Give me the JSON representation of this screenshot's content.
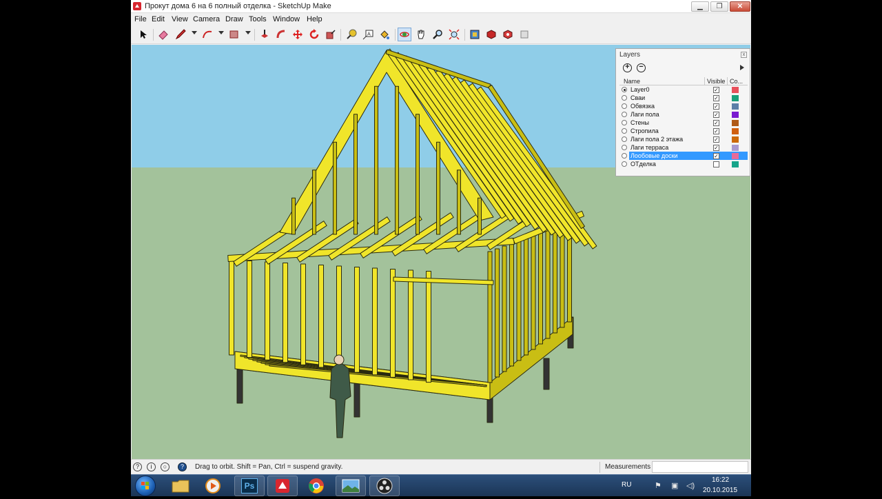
{
  "window": {
    "title": "Прокут дома 6 на 6 полный отделка - SketchUp Make",
    "minimize": "▁",
    "maximize": "❐",
    "close": "✕"
  },
  "menu": [
    "File",
    "Edit",
    "View",
    "Camera",
    "Draw",
    "Tools",
    "Window",
    "Help"
  ],
  "toolbar": {
    "tools": [
      "select-icon",
      "eraser-icon",
      "pencil-icon",
      "arc-icon",
      "rectangle-icon",
      "push-pull-icon",
      "follow-me-icon",
      "move-icon",
      "rotate-icon",
      "scale-icon",
      "tape-measure-icon",
      "text-icon",
      "paint-bucket-icon",
      "orbit-icon",
      "pan-icon",
      "zoom-icon",
      "zoom-extents-icon",
      "warehouse-icon",
      "extension-icon",
      "components-icon",
      "layout-icon"
    ],
    "active_tool": "orbit-icon"
  },
  "layers_panel": {
    "title": "Layers",
    "add": "+",
    "remove": "−",
    "columns": {
      "name": "Name",
      "visible": "Visible",
      "color": "Co..."
    },
    "rows": [
      {
        "name": "Layer0",
        "current": true,
        "visible": true,
        "color": "#e8505b"
      },
      {
        "name": "Сваи",
        "current": false,
        "visible": true,
        "color": "#1aa07a"
      },
      {
        "name": "Обвязка",
        "current": false,
        "visible": true,
        "color": "#5c7fa8"
      },
      {
        "name": "Лаги пола",
        "current": false,
        "visible": true,
        "color": "#7a1ad0"
      },
      {
        "name": "Стены",
        "current": false,
        "visible": true,
        "color": "#b05a18"
      },
      {
        "name": "Стропила",
        "current": false,
        "visible": true,
        "color": "#d06010"
      },
      {
        "name": "Лаги пола 2 этажа",
        "current": false,
        "visible": true,
        "color": "#cc6a0a"
      },
      {
        "name": "Лаги терраса",
        "current": false,
        "visible": true,
        "color": "#a89ad0"
      },
      {
        "name": "Лообовые доски",
        "current": false,
        "visible": true,
        "color": "#e86a9a",
        "selected": true
      },
      {
        "name": "ОТделка",
        "current": false,
        "visible": false,
        "color": "#17a58a"
      }
    ]
  },
  "status": {
    "hint": "Drag to orbit. Shift = Pan, Ctrl = suspend gravity.",
    "measurements_label": "Measurements",
    "measurements_value": ""
  },
  "taskbar": {
    "apps": [
      "windows-start",
      "file-explorer-icon",
      "media-player-icon",
      "photoshop-icon",
      "sketchup-icon",
      "chrome-icon",
      "photo-viewer-icon",
      "obs-icon"
    ],
    "ps_label": "Ps",
    "language": "RU",
    "time": "16:22",
    "date": "20.10.2015"
  },
  "colors": {
    "sky": "#8fcde8",
    "ground": "#a3c29b",
    "timber": "#f0e52a",
    "timber_shade": "#c9be14",
    "selection": "#3399ff"
  }
}
